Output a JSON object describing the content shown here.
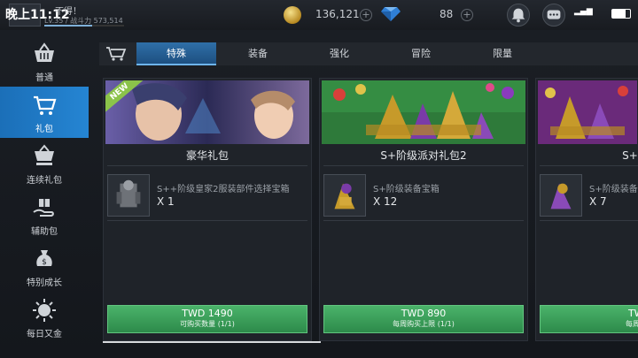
{
  "status": {
    "time": "晚上11:12"
  },
  "player": {
    "name": "不得！",
    "info": "Lv.35 / 战斗力 573,514"
  },
  "currency": {
    "gold": "136,121",
    "gems": "88"
  },
  "sidebar": {
    "items": [
      {
        "label": "普通",
        "icon": "basket-icon"
      },
      {
        "label": "礼包",
        "icon": "cart-icon"
      },
      {
        "label": "连续礼包",
        "icon": "basket-stack-icon"
      },
      {
        "label": "辅助包",
        "icon": "hand-gift-icon"
      },
      {
        "label": "特别成长",
        "icon": "money-bag-icon"
      },
      {
        "label": "每日又金",
        "icon": "sun-medal-icon"
      }
    ]
  },
  "tabs": [
    "特殊",
    "装备",
    "强化",
    "冒险",
    "限量"
  ],
  "badge": "NEW",
  "cards": [
    {
      "title": "豪华礼包",
      "item_name": "S++阶级皇家2服装部件选择宝箱",
      "item_qty": "X 1",
      "price": "TWD 1490",
      "limit": "可购买数量 (1/1)"
    },
    {
      "title": "S+阶级派对礼包2",
      "item_name": "S+阶级装备宝箱",
      "item_qty": "X 12",
      "price": "TWD 890",
      "limit": "每周购买上限 (1/1)"
    },
    {
      "title": "S+阶级",
      "item_name": "S+阶级装备",
      "item_qty": "X 7",
      "price": "TWD",
      "limit": "每周购买"
    }
  ],
  "colors": {
    "accent": "#2585d3",
    "buy": "#3fa35f",
    "gold": "#d9b43a"
  }
}
